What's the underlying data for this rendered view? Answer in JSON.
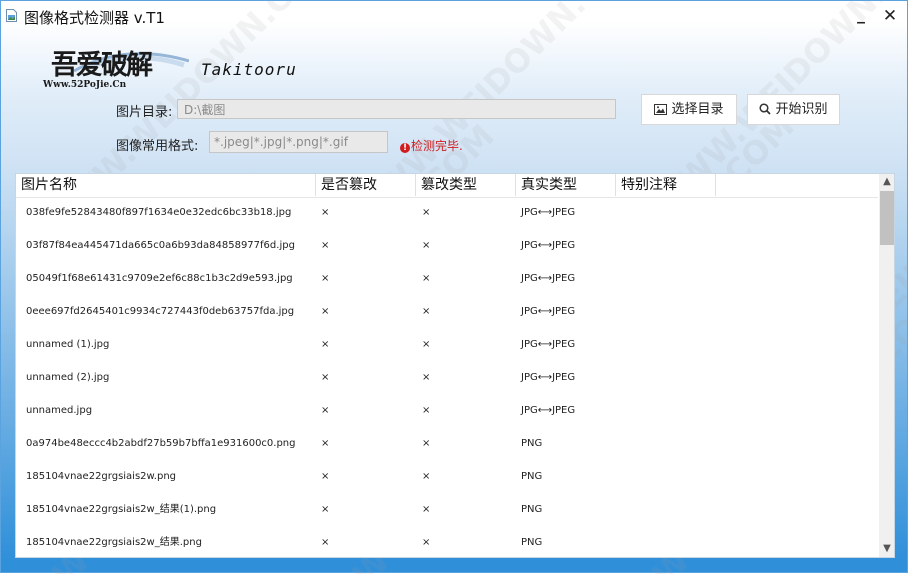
{
  "window": {
    "title": "图像格式检测器 v.T1",
    "minimize_glyph": "▁",
    "close_glyph": "✕"
  },
  "logo": {
    "main": "吾爱破解",
    "sub": "Www.52PoJie.Cn"
  },
  "author": "Takitooru",
  "form": {
    "dir_label": "图片目录:",
    "dir_value": "D:\\截图",
    "fmt_label": "图像常用格式:",
    "fmt_value": "*.jpeg|*.jpg|*.png|*.gif",
    "status_text": "检测完毕."
  },
  "buttons": {
    "choose_label": "选择目录",
    "start_label": "开始识别"
  },
  "table": {
    "columns": [
      "图片名称",
      "是否篡改",
      "篡改类型",
      "真实类型",
      "特别注释"
    ],
    "rows": [
      [
        "038fe9fe52843480f897f1634e0e32edc6bc33b18.jpg",
        "×",
        "×",
        "JPG⟷JPEG"
      ],
      [
        "03f87f84ea445471da665c0a6b93da84858977f6d.jpg",
        "×",
        "×",
        "JPG⟷JPEG"
      ],
      [
        "05049f1f68e61431c9709e2ef6c88c1b3c2d9e593.jpg",
        "×",
        "×",
        "JPG⟷JPEG"
      ],
      [
        "0eee697fd2645401c9934c727443f0deb63757fda.jpg",
        "×",
        "×",
        "JPG⟷JPEG"
      ],
      [
        "unnamed (1).jpg",
        "×",
        "×",
        "JPG⟷JPEG"
      ],
      [
        "unnamed (2).jpg",
        "×",
        "×",
        "JPG⟷JPEG"
      ],
      [
        "unnamed.jpg",
        "×",
        "×",
        "JPG⟷JPEG"
      ],
      [
        "0a974be48eccc4b2abdf27b59b7bffa1e931600c0.png",
        "×",
        "×",
        "PNG"
      ],
      [
        "185104vnae22grgsiais2w.png",
        "×",
        "×",
        "PNG"
      ],
      [
        "185104vnae22grgsiais2w_结果(1).png",
        "×",
        "×",
        "PNG"
      ],
      [
        "185104vnae22grgsiais2w_结果.png",
        "×",
        "×",
        "PNG"
      ]
    ]
  },
  "scrollbar": {
    "up_glyph": "▲",
    "down_glyph": "▼"
  },
  "watermark_text": "WWW.WEIDOWN.COM",
  "icons": [
    "app-icon",
    "image-icon",
    "search-icon",
    "error-icon",
    "logo-swoosh"
  ],
  "colors": {
    "status_red": "#d11d1d",
    "bg_blue_bottom": "#2f8fd9",
    "input_bg": "#e9e9e9"
  }
}
